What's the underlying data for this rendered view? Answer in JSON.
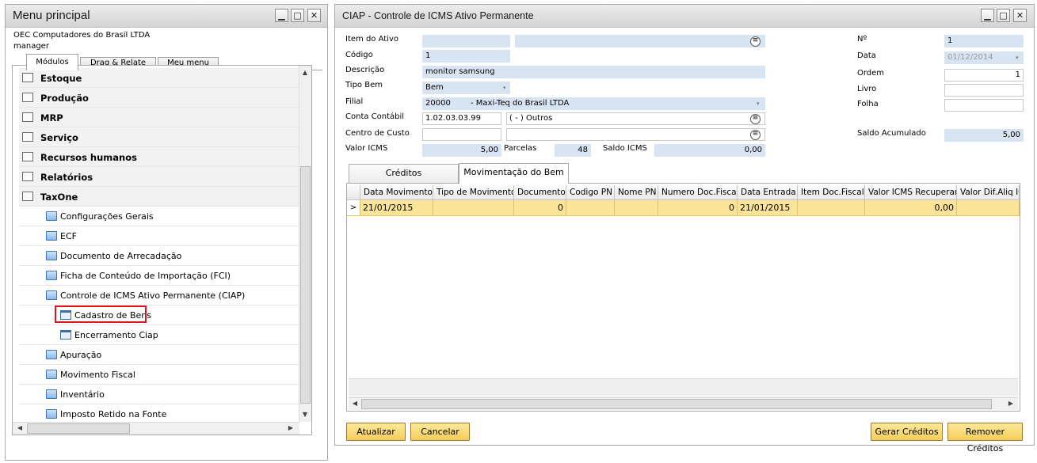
{
  "left_window": {
    "title": "Menu principal",
    "company": "OEC Computadores do Brasil LTDA",
    "user": "manager",
    "tabs": [
      {
        "label": "Módulos"
      },
      {
        "label": "Drag & Relate"
      },
      {
        "label": "Meu menu"
      }
    ],
    "top_items": [
      {
        "label": "Estoque",
        "icon": "inventory-icon"
      },
      {
        "label": "Produção",
        "icon": "production-icon"
      },
      {
        "label": "MRP",
        "icon": "mrp-icon"
      },
      {
        "label": "Serviço",
        "icon": "service-icon"
      },
      {
        "label": "Recursos humanos",
        "icon": "hr-icon"
      },
      {
        "label": "Relatórios",
        "icon": "reports-icon"
      },
      {
        "label": "TaxOne",
        "icon": "taxone-icon"
      }
    ],
    "taxone_items": [
      {
        "label": "Configurações Gerais"
      },
      {
        "label": "ECF"
      },
      {
        "label": "Documento de Arrecadação"
      },
      {
        "label": "Ficha de Conteúdo de Importação (FCI)"
      },
      {
        "label": "Controle de ICMS Ativo Permanente (CIAP)"
      }
    ],
    "ciap_items": [
      {
        "label": "Cadastro de Bens"
      },
      {
        "label": "Encerramento Ciap"
      }
    ],
    "more_items": [
      {
        "label": "Apuração"
      },
      {
        "label": "Movimento Fiscal"
      },
      {
        "label": "Inventário"
      },
      {
        "label": "Imposto Retido na Fonte"
      }
    ]
  },
  "right_window": {
    "title": "CIAP - Controle de ICMS Ativo Permanente",
    "fields": {
      "item_do_ativo": {
        "label": "Item do Ativo",
        "value": "",
        "value2": ""
      },
      "codigo": {
        "label": "Código",
        "value": "1"
      },
      "descricao": {
        "label": "Descrição",
        "value": "monitor samsung"
      },
      "tipo_bem": {
        "label": "Tipo Bem",
        "value": "Bem"
      },
      "filial": {
        "label": "Filial",
        "code": "20000",
        "name": "- Maxi-Teq do Brasil LTDA"
      },
      "conta_contabil": {
        "label": "Conta Contábil",
        "value": "1.02.03.03.99",
        "desc": "( - ) Outros"
      },
      "centro_de_custo": {
        "label": "Centro de Custo",
        "value": "",
        "desc": ""
      },
      "valor_icms": {
        "label": "Valor ICMS",
        "value": "5,00"
      },
      "parcelas": {
        "label": "Parcelas",
        "value": "48"
      },
      "saldo_icms": {
        "label": "Saldo ICMS",
        "value": "0,00"
      },
      "numero": {
        "label": "Nº",
        "value": "1"
      },
      "data": {
        "label": "Data",
        "value": "01/12/2014"
      },
      "ordem": {
        "label": "Ordem",
        "value": "1"
      },
      "livro": {
        "label": "Livro",
        "value": ""
      },
      "folha": {
        "label": "Folha",
        "value": ""
      },
      "saldo_acumulado": {
        "label": "Saldo Acumulado",
        "value": "5,00"
      }
    },
    "tabs": [
      {
        "label": "Créditos"
      },
      {
        "label": "Movimentação do Bem"
      }
    ],
    "grid": {
      "columns": [
        "Data Movimento",
        "Tipo de Movimento",
        "Documento",
        "Codigo PN",
        "Nome PN",
        "Numero Doc.Fiscal",
        "Data Entrada",
        "Item Doc.Fiscal",
        "Valor ICMS Recuperar",
        "Valor Dif.Aliq IC"
      ],
      "rows": [
        {
          "cells": [
            "21/01/2015",
            "",
            "0",
            "",
            "",
            "0",
            "21/01/2015",
            "",
            "0,00",
            ""
          ]
        }
      ]
    },
    "buttons": {
      "atualizar": "Atualizar",
      "cancelar": "Cancelar",
      "gerar": "Gerar Créditos",
      "remover": "Remover Créditos"
    }
  },
  "colors": {
    "accent_yellow": "#f5cd5a",
    "readonly_blue": "#d8e4f1",
    "selected_row": "#fbe497",
    "highlight_red": "#e0141e"
  }
}
